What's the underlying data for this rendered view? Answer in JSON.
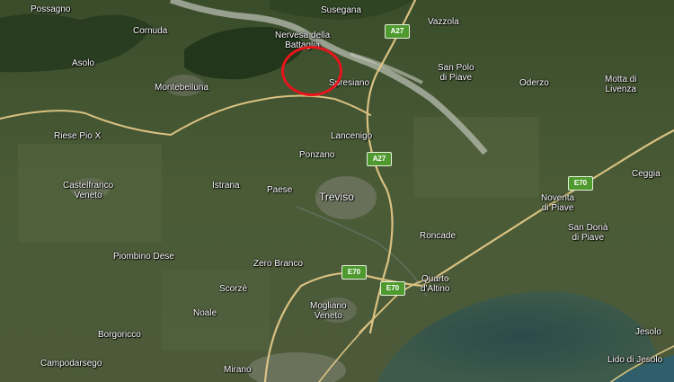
{
  "map": {
    "type": "satellite",
    "marker_color": "#e8141c",
    "road_color": "#e9cd8a",
    "places": [
      {
        "id": "possagno",
        "label": "Possagno"
      },
      {
        "id": "susegana",
        "label": "Susegana"
      },
      {
        "id": "vazzola",
        "label": "Vazzola"
      },
      {
        "id": "cornuda",
        "label": "Cornuda"
      },
      {
        "id": "nervesa",
        "label": "Nervesa della\nBattaglia"
      },
      {
        "id": "asolo",
        "label": "Asolo"
      },
      {
        "id": "san-polo",
        "label": "San Polo\ndi Piave"
      },
      {
        "id": "motta",
        "label": "Motta di\nLivenza"
      },
      {
        "id": "montebelluna",
        "label": "Montebelluna"
      },
      {
        "id": "spresiano",
        "label": "Spresiano"
      },
      {
        "id": "oderzo",
        "label": "Oderzo"
      },
      {
        "id": "riese",
        "label": "Riese Pio X"
      },
      {
        "id": "lancenigo",
        "label": "Lancenigo"
      },
      {
        "id": "ponzano",
        "label": "Ponzano"
      },
      {
        "id": "ceggia",
        "label": "Ceggia"
      },
      {
        "id": "castelfranco",
        "label": "Castelfranco\nVeneto"
      },
      {
        "id": "istrana",
        "label": "Istrana"
      },
      {
        "id": "paese",
        "label": "Paese"
      },
      {
        "id": "treviso",
        "label": "Treviso"
      },
      {
        "id": "noventa",
        "label": "Noventa\ndi Piave"
      },
      {
        "id": "san-dona",
        "label": "San Donà\ndi Piave"
      },
      {
        "id": "roncade",
        "label": "Roncade"
      },
      {
        "id": "piombino",
        "label": "Piombino Dese"
      },
      {
        "id": "zero-branco",
        "label": "Zero Branco"
      },
      {
        "id": "quarto",
        "label": "Quarto\nd'Altino"
      },
      {
        "id": "scorze",
        "label": "Scorzè"
      },
      {
        "id": "mogliano",
        "label": "Mogliano\nVeneto"
      },
      {
        "id": "noale",
        "label": "Noale"
      },
      {
        "id": "borgoricco",
        "label": "Borgoricco"
      },
      {
        "id": "jesolo",
        "label": "Jesolo"
      },
      {
        "id": "campodarsego",
        "label": "Campodarsego"
      },
      {
        "id": "mirano",
        "label": "Mirano"
      },
      {
        "id": "lido",
        "label": "Lido di Jesolo"
      }
    ],
    "shields": [
      {
        "id": "a27-north",
        "label": "A27"
      },
      {
        "id": "a27-south",
        "label": "A27"
      },
      {
        "id": "e70-west",
        "label": "E70"
      },
      {
        "id": "e70-center",
        "label": "E70"
      },
      {
        "id": "e70-east",
        "label": "E70"
      }
    ]
  }
}
